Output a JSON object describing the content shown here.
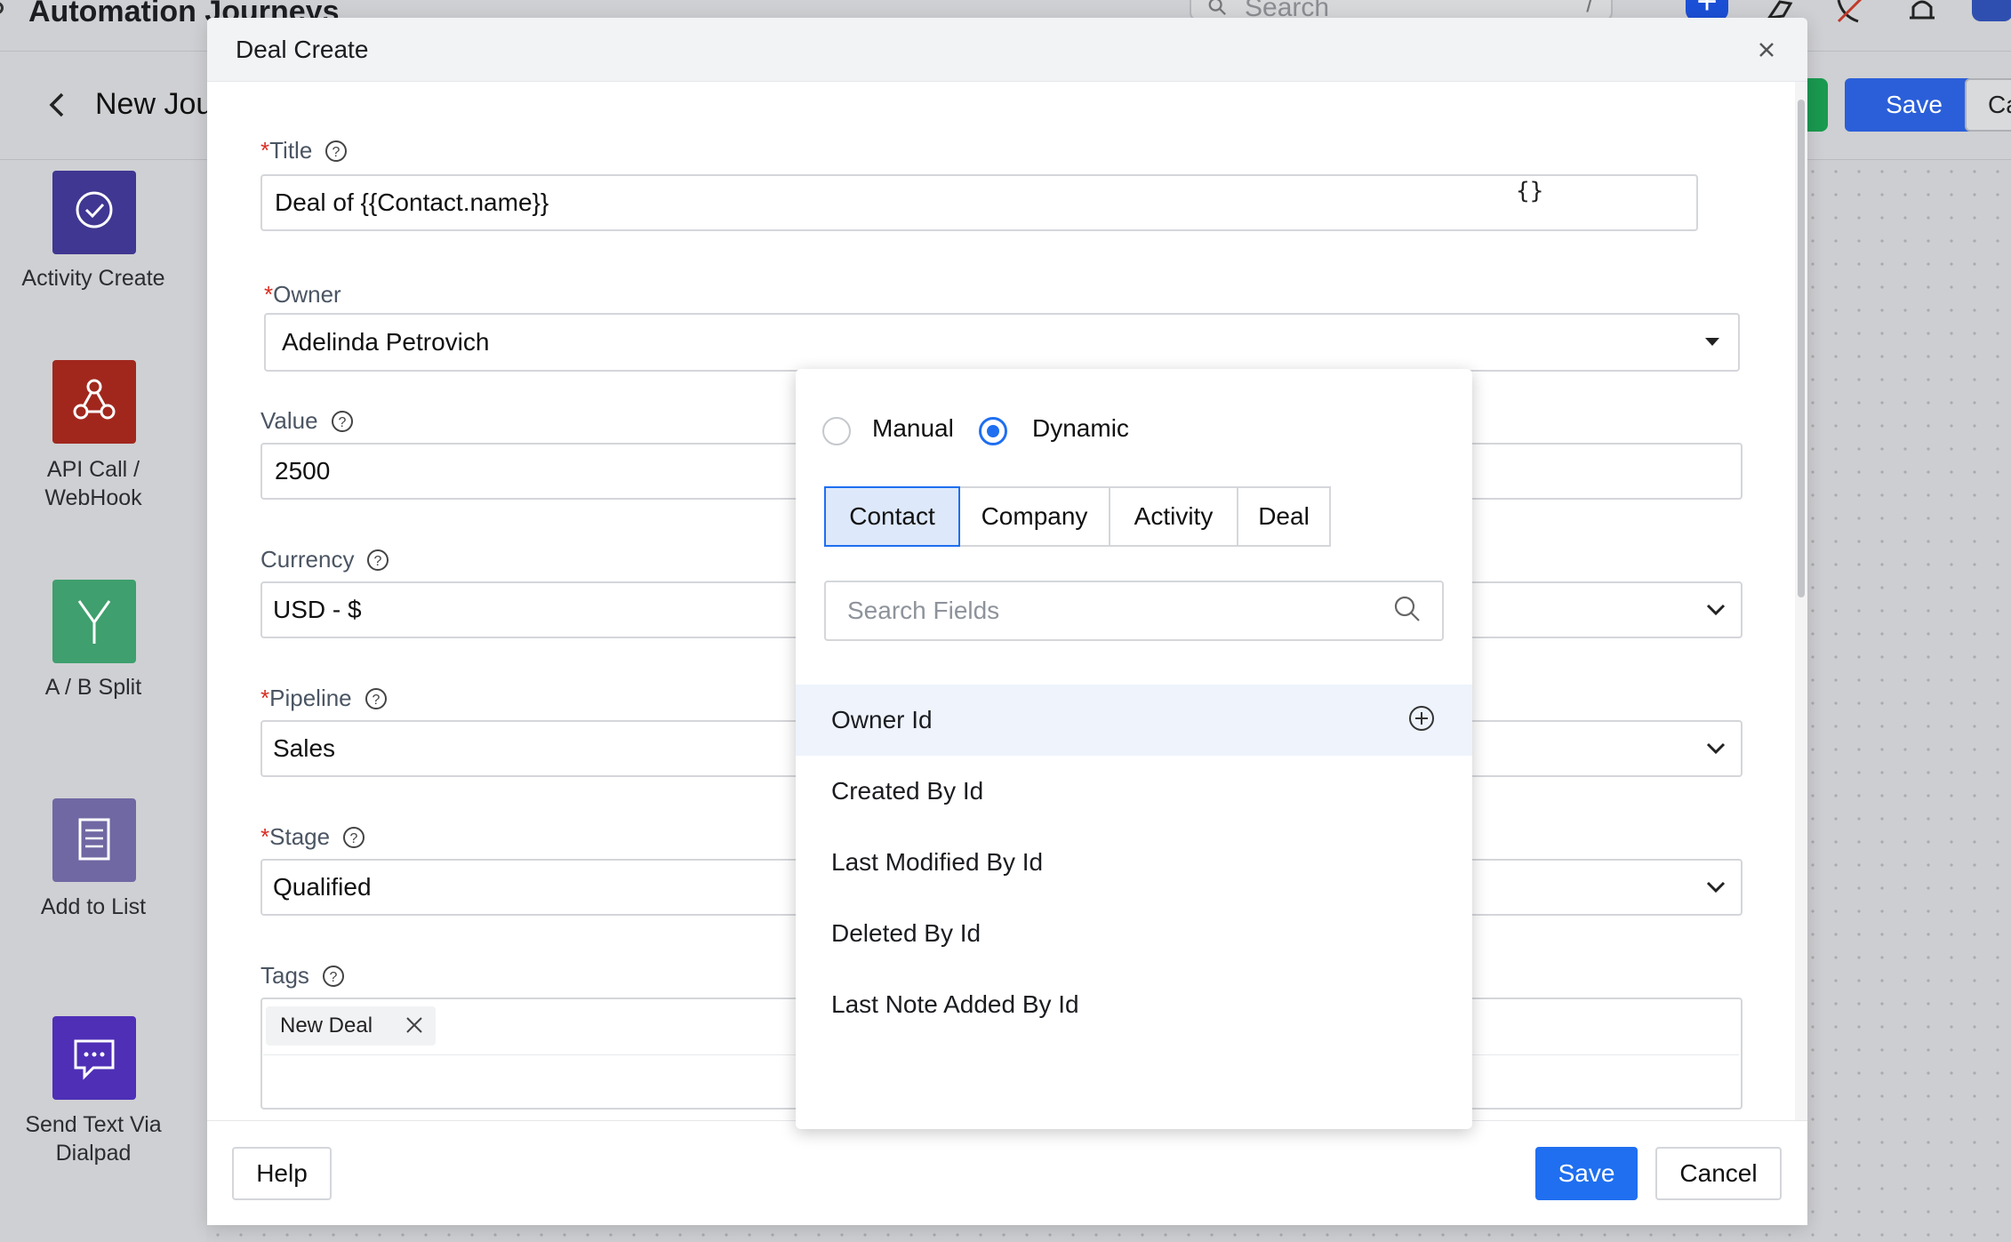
{
  "app": {
    "title": "Automation Journeys",
    "search_placeholder": "Search",
    "search_shortcut": "/",
    "journey_name": "New Jou",
    "save_label": "Save",
    "cancel_label": "Ca"
  },
  "sidebar": {
    "tiles": [
      {
        "label": "Activity Create",
        "color": "#3f3791",
        "icon": "check-circle-icon"
      },
      {
        "label": "API Call / WebHook",
        "color": "#a1271d",
        "icon": "webhook-icon"
      },
      {
        "label": "A / B Split",
        "color": "#3f9f6e",
        "icon": "split-icon"
      },
      {
        "label": "Add to List",
        "color": "#6f68a3",
        "icon": "list-icon"
      },
      {
        "label": "Send Text Via Dialpad",
        "color": "#4e2fb6",
        "icon": "chat-icon"
      }
    ]
  },
  "modal": {
    "title": "Deal Create",
    "fields": {
      "title": {
        "label": "Title",
        "required": "*",
        "value": "Deal of {{Contact.name}}",
        "braces": "{}"
      },
      "owner": {
        "label": "Owner",
        "required": "*",
        "value": "Adelinda Petrovich"
      },
      "value": {
        "label": "Value",
        "value": "2500"
      },
      "currency": {
        "label": "Currency",
        "value": "USD - $"
      },
      "pipeline": {
        "label": "Pipeline",
        "required": "*",
        "value": "Sales"
      },
      "stage": {
        "label": "Stage",
        "required": "*",
        "value": "Qualified"
      },
      "tags": {
        "label": "Tags",
        "chips": [
          "New Deal"
        ]
      }
    },
    "footer": {
      "help": "Help",
      "save": "Save",
      "cancel": "Cancel"
    }
  },
  "popover": {
    "modes": [
      "Manual",
      "Dynamic"
    ],
    "selected_mode": "Dynamic",
    "tabs": [
      "Contact",
      "Company",
      "Activity",
      "Deal"
    ],
    "active_tab": "Contact",
    "search_placeholder": "Search Fields",
    "items": [
      "Owner Id",
      "Created By Id",
      "Last Modified By Id",
      "Deleted By Id",
      "Last Note Added By Id"
    ],
    "highlighted_item": "Owner Id"
  },
  "colors": {
    "primary": "#1f6ff0",
    "required": "#d92d20",
    "tab_active_bg": "#dde8fb"
  }
}
